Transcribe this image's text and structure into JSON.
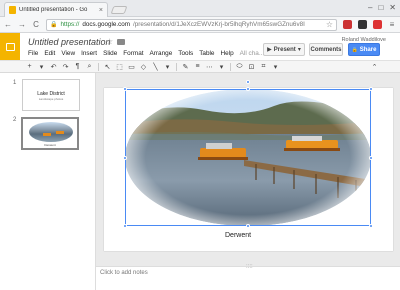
{
  "browser": {
    "tab_title": "Untitled presentation - Go",
    "url_scheme": "https://",
    "url_host": "docs.google.com",
    "url_path": "/presentation/d/1JeXczEWVzKrj-br5lhqRyhVm65swGZnu6v8I",
    "tab_close": "×",
    "minimize": "–",
    "maximize": "□",
    "close": "✕",
    "back": "←",
    "forward": "→",
    "reload": "C",
    "bookmark_star": "☆",
    "menu": "≡",
    "ext_colors": [
      "#c33",
      "#333",
      "#d33",
      "#555"
    ]
  },
  "app": {
    "doc_title": "Untitled presentation",
    "title_star": "☆",
    "user_name": "Roland Waddilove",
    "menus": [
      "File",
      "Edit",
      "View",
      "Insert",
      "Slide",
      "Format",
      "Arrange",
      "Tools",
      "Table",
      "Help"
    ],
    "menu_overflow": "All cha...",
    "present_label": "Present",
    "present_dropdown": "▾",
    "comments_label": "Comments",
    "share_label": "Share",
    "share_icon": "🔒",
    "accent": "#f4b400",
    "share_color": "#4a8af4"
  },
  "toolbar": {
    "items": [
      "+",
      "▾",
      "↶",
      "↷",
      "¶",
      "⌕",
      "↖",
      "⬚",
      "▭",
      "◇",
      "╲",
      "▾",
      "✎",
      "≡",
      "⋯",
      "▾",
      "⬭",
      "⊡",
      "⌗",
      "▾"
    ],
    "collapse": "⌃"
  },
  "filmstrip": {
    "slide1_num": "1",
    "slide1_title": "Lake District",
    "slide1_subtitle": "Landscape photos",
    "slide2_num": "2",
    "slide2_caption": "Derwent"
  },
  "slide": {
    "caption": "Derwent"
  },
  "notes": {
    "placeholder": "Click to add notes",
    "grip": "::::"
  }
}
